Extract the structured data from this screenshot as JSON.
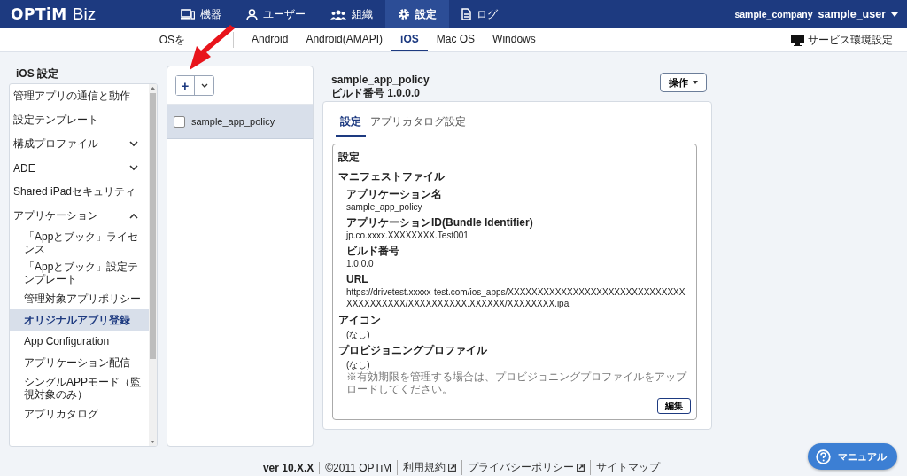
{
  "header": {
    "logo": "OPTiM",
    "product": "Biz",
    "nav": [
      {
        "label": "機器",
        "selected": false
      },
      {
        "label": "ユーザー",
        "selected": false
      },
      {
        "label": "組織",
        "selected": false
      },
      {
        "label": "設定",
        "selected": true
      },
      {
        "label": "ログ",
        "selected": false
      }
    ],
    "company": "sample_company",
    "user": "sample_user"
  },
  "subnav": {
    "label": "OSを",
    "tabs": [
      {
        "label": "Android",
        "selected": false
      },
      {
        "label": "Android(AMAPI)",
        "selected": false
      },
      {
        "label": "iOS",
        "selected": true
      },
      {
        "label": "Mac OS",
        "selected": false
      },
      {
        "label": "Windows",
        "selected": false
      }
    ],
    "service_settings": "サービス環境設定"
  },
  "sidebar": {
    "title": "iOS 設定",
    "items": [
      {
        "label": "管理アプリの通信と動作"
      },
      {
        "label": "設定テンプレート"
      },
      {
        "label": "構成プロファイル",
        "expanded": false
      },
      {
        "label": "ADE",
        "expanded": false
      },
      {
        "label": "Shared iPadセキュリティ"
      },
      {
        "label": "アプリケーション",
        "expanded": true,
        "children": [
          {
            "label": "「Appとブック」ライセンス",
            "selected": false
          },
          {
            "label": "「Appとブック」設定テンプレート",
            "selected": false
          },
          {
            "label": "管理対象アプリポリシー",
            "selected": false
          },
          {
            "label": "オリジナルアプリ登録",
            "selected": true
          },
          {
            "label": "App Configuration",
            "selected": false
          },
          {
            "label": "アプリケーション配信",
            "selected": false
          },
          {
            "label": "シングルAPPモード（監視対象のみ）",
            "selected": false
          },
          {
            "label": "アプリカタログ",
            "selected": false
          }
        ]
      }
    ]
  },
  "list": {
    "add_button": "+",
    "rows": [
      {
        "label": "sample_app_policy",
        "checked": false,
        "selected": true
      }
    ]
  },
  "detail": {
    "title": "sample_app_policy",
    "build": "ビルド番号 1.0.0.0",
    "action_button": "操作",
    "tabs": [
      {
        "label": "設定",
        "selected": true
      },
      {
        "label": "アプリカタログ設定",
        "selected": false
      }
    ],
    "section_title": "設定",
    "group_title": "マニフェストファイル",
    "manifest": [
      {
        "label": "アプリケーション名",
        "value": "sample_app_policy"
      },
      {
        "label": "アプリケーションID(Bundle Identifier)",
        "value": "jp.co.xxxx.XXXXXXXX.Test001"
      },
      {
        "label": "ビルド番号",
        "value": "1.0.0.0"
      },
      {
        "label": "URL",
        "value": "https://drivetest.xxxxx-test.com/ios_apps/XXXXXXXXXXXXXXXXXXXXXXXXXXXXXXXXXXXXXXXX/XXXXXXXXXX.XXXXXX/XXXXXXXX.ipa"
      }
    ],
    "others": [
      {
        "label": "アイコン",
        "value": "(なし)"
      },
      {
        "label": "プロビジョニングプロファイル",
        "value": "(なし)",
        "note": "※有効期限を管理する場合は、プロビジョニングプロファイルをアップロードしてください。"
      }
    ],
    "edit_button": "編集"
  },
  "footer": {
    "version": "ver 10.X.X",
    "copyright": "©2011 OPTiM",
    "links": [
      {
        "label": "利用規約",
        "external": true
      },
      {
        "label": "プライバシーポリシー",
        "external": true
      },
      {
        "label": "サイトマップ",
        "external": false
      }
    ]
  },
  "manual_button": "マニュアル"
}
